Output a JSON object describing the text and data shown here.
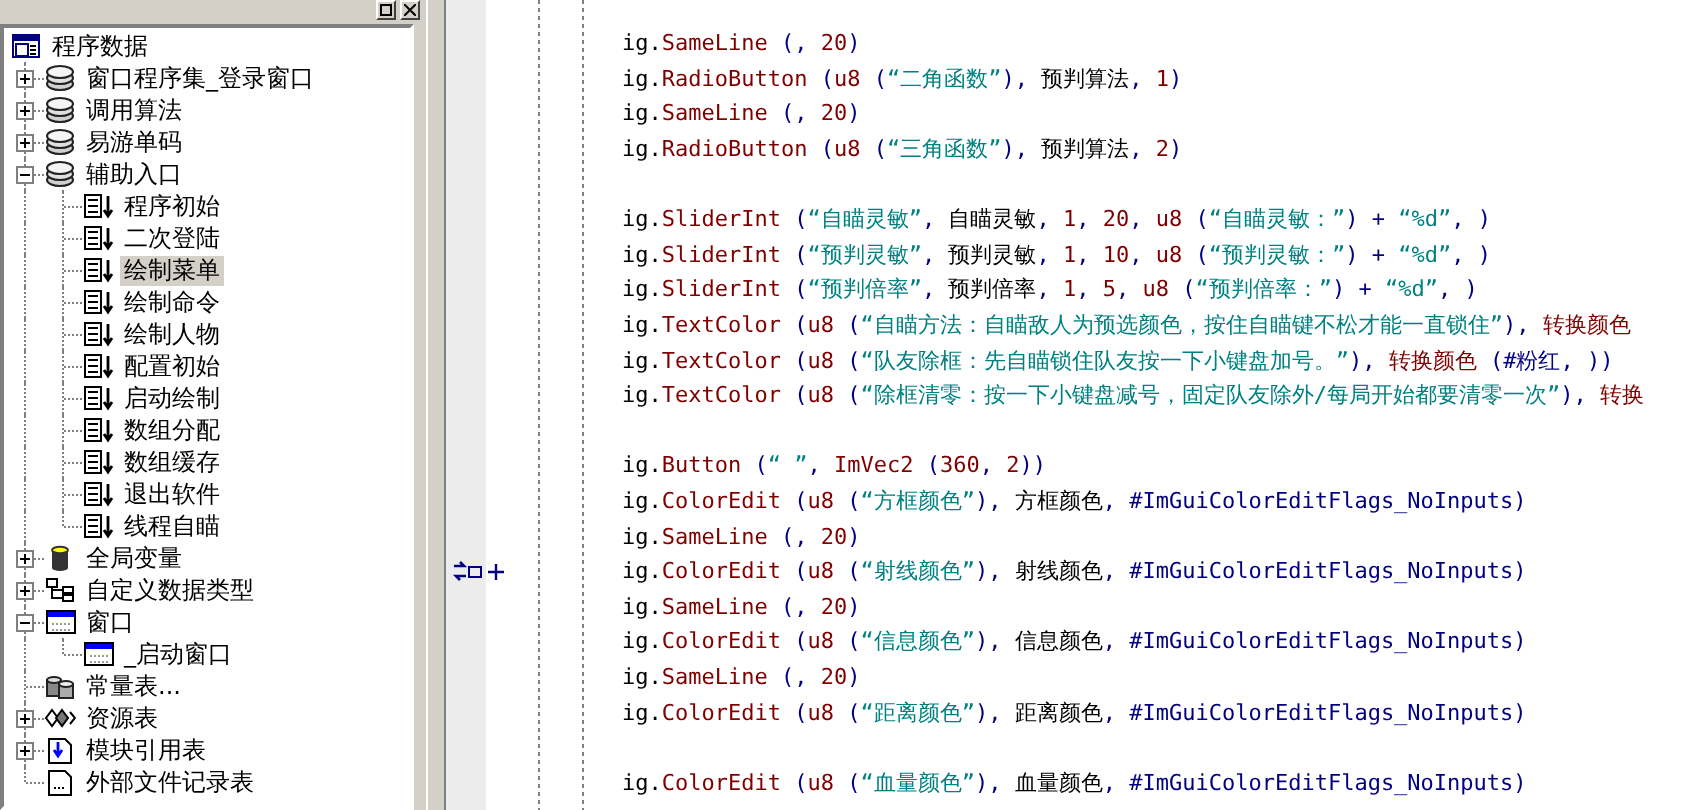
{
  "tree": [
    {
      "label": "程序数据",
      "kind": "program",
      "selected": false,
      "children": [
        {
          "label": "窗口程序集_登录窗口",
          "kind": "module",
          "selected": false,
          "expanded": false
        },
        {
          "label": "调用算法",
          "kind": "module",
          "selected": false,
          "expanded": false
        },
        {
          "label": "易游单码",
          "kind": "module",
          "selected": false,
          "expanded": false
        },
        {
          "label": "辅助入口",
          "kind": "module",
          "selected": false,
          "expanded": true,
          "children": [
            {
              "label": "程序初始",
              "kind": "sub",
              "selected": false
            },
            {
              "label": "二次登陆",
              "kind": "sub",
              "selected": false
            },
            {
              "label": "绘制菜单",
              "kind": "sub",
              "selected": true
            },
            {
              "label": "绘制命令",
              "kind": "sub",
              "selected": false
            },
            {
              "label": "绘制人物",
              "kind": "sub",
              "selected": false
            },
            {
              "label": "配置初始",
              "kind": "sub",
              "selected": false
            },
            {
              "label": "启动绘制",
              "kind": "sub",
              "selected": false
            },
            {
              "label": "数组分配",
              "kind": "sub",
              "selected": false
            },
            {
              "label": "数组缓存",
              "kind": "sub",
              "selected": false
            },
            {
              "label": "退出软件",
              "kind": "sub",
              "selected": false
            },
            {
              "label": "线程自瞄",
              "kind": "sub",
              "selected": false
            }
          ]
        },
        {
          "label": "全局变量",
          "kind": "globals",
          "selected": false,
          "expanded": false
        },
        {
          "label": "自定义数据类型",
          "kind": "datatype",
          "selected": false,
          "expanded": false
        },
        {
          "label": "窗口",
          "kind": "window",
          "selected": false,
          "expanded": true,
          "children": [
            {
              "label": "_启动窗口",
              "kind": "window",
              "selected": false
            }
          ]
        },
        {
          "label": "常量表...",
          "kind": "constants",
          "selected": false
        },
        {
          "label": "资源表",
          "kind": "resources",
          "selected": false,
          "expanded": false
        },
        {
          "label": "模块引用表",
          "kind": "modref",
          "selected": false,
          "expanded": false
        },
        {
          "label": "外部文件记录表",
          "kind": "file",
          "selected": false
        }
      ]
    }
  ],
  "code_lines": [
    {
      "marker": false,
      "tokens": [
        {
          "kind": "obj",
          "text": "ig."
        },
        {
          "kind": "func",
          "text": "SameLine"
        },
        {
          "kind": "punct",
          "text": " (, "
        },
        {
          "kind": "num",
          "text": "20"
        },
        {
          "kind": "punct",
          "text": ")"
        }
      ]
    },
    {
      "marker": false,
      "tokens": [
        {
          "kind": "obj",
          "text": "ig."
        },
        {
          "kind": "func",
          "text": "RadioButton"
        },
        {
          "kind": "punct",
          "text": " ("
        },
        {
          "kind": "func",
          "text": "u8"
        },
        {
          "kind": "punct",
          "text": " ("
        },
        {
          "kind": "str",
          "text": "“二角函数”"
        },
        {
          "kind": "punct",
          "text": "), "
        },
        {
          "kind": "var",
          "text": "预判算法"
        },
        {
          "kind": "punct",
          "text": ", "
        },
        {
          "kind": "num",
          "text": "1"
        },
        {
          "kind": "punct",
          "text": ")"
        }
      ]
    },
    {
      "marker": false,
      "tokens": [
        {
          "kind": "obj",
          "text": "ig."
        },
        {
          "kind": "func",
          "text": "SameLine"
        },
        {
          "kind": "punct",
          "text": " (, "
        },
        {
          "kind": "num",
          "text": "20"
        },
        {
          "kind": "punct",
          "text": ")"
        }
      ]
    },
    {
      "marker": false,
      "tokens": [
        {
          "kind": "obj",
          "text": "ig."
        },
        {
          "kind": "func",
          "text": "RadioButton"
        },
        {
          "kind": "punct",
          "text": " ("
        },
        {
          "kind": "func",
          "text": "u8"
        },
        {
          "kind": "punct",
          "text": " ("
        },
        {
          "kind": "str",
          "text": "“三角函数”"
        },
        {
          "kind": "punct",
          "text": "), "
        },
        {
          "kind": "var",
          "text": "预判算法"
        },
        {
          "kind": "punct",
          "text": ", "
        },
        {
          "kind": "num",
          "text": "2"
        },
        {
          "kind": "punct",
          "text": ")"
        }
      ]
    },
    {
      "marker": false
    },
    {
      "marker": false,
      "tokens": [
        {
          "kind": "obj",
          "text": "ig."
        },
        {
          "kind": "func",
          "text": "SliderInt"
        },
        {
          "kind": "punct",
          "text": " ("
        },
        {
          "kind": "str",
          "text": "“自瞄灵敏”"
        },
        {
          "kind": "punct",
          "text": ", "
        },
        {
          "kind": "var",
          "text": "自瞄灵敏"
        },
        {
          "kind": "punct",
          "text": ", "
        },
        {
          "kind": "num",
          "text": "1"
        },
        {
          "kind": "punct",
          "text": ", "
        },
        {
          "kind": "num",
          "text": "20"
        },
        {
          "kind": "punct",
          "text": ", "
        },
        {
          "kind": "func",
          "text": "u8"
        },
        {
          "kind": "punct",
          "text": " ("
        },
        {
          "kind": "str",
          "text": "“自瞄灵敏：”"
        },
        {
          "kind": "punct",
          "text": ") + "
        },
        {
          "kind": "str",
          "text": "“%d”"
        },
        {
          "kind": "punct",
          "text": ", )"
        }
      ]
    },
    {
      "marker": false,
      "tokens": [
        {
          "kind": "obj",
          "text": "ig."
        },
        {
          "kind": "func",
          "text": "SliderInt"
        },
        {
          "kind": "punct",
          "text": " ("
        },
        {
          "kind": "str",
          "text": "“预判灵敏”"
        },
        {
          "kind": "punct",
          "text": ", "
        },
        {
          "kind": "var",
          "text": "预判灵敏"
        },
        {
          "kind": "punct",
          "text": ", "
        },
        {
          "kind": "num",
          "text": "1"
        },
        {
          "kind": "punct",
          "text": ", "
        },
        {
          "kind": "num",
          "text": "10"
        },
        {
          "kind": "punct",
          "text": ", "
        },
        {
          "kind": "func",
          "text": "u8"
        },
        {
          "kind": "punct",
          "text": " ("
        },
        {
          "kind": "str",
          "text": "“预判灵敏：”"
        },
        {
          "kind": "punct",
          "text": ") + "
        },
        {
          "kind": "str",
          "text": "“%d”"
        },
        {
          "kind": "punct",
          "text": ", )"
        }
      ]
    },
    {
      "marker": false,
      "tokens": [
        {
          "kind": "obj",
          "text": "ig."
        },
        {
          "kind": "func",
          "text": "SliderInt"
        },
        {
          "kind": "punct",
          "text": " ("
        },
        {
          "kind": "str",
          "text": "“预判倍率”"
        },
        {
          "kind": "punct",
          "text": ", "
        },
        {
          "kind": "var",
          "text": "预判倍率"
        },
        {
          "kind": "punct",
          "text": ", "
        },
        {
          "kind": "num",
          "text": "1"
        },
        {
          "kind": "punct",
          "text": ", "
        },
        {
          "kind": "num",
          "text": "5"
        },
        {
          "kind": "punct",
          "text": ", "
        },
        {
          "kind": "func",
          "text": "u8"
        },
        {
          "kind": "punct",
          "text": " ("
        },
        {
          "kind": "str",
          "text": "“预判倍率：”"
        },
        {
          "kind": "punct",
          "text": ") + "
        },
        {
          "kind": "str",
          "text": "“%d”"
        },
        {
          "kind": "punct",
          "text": ", )"
        }
      ]
    },
    {
      "marker": false,
      "tokens": [
        {
          "kind": "obj",
          "text": "ig."
        },
        {
          "kind": "func",
          "text": "TextColor"
        },
        {
          "kind": "punct",
          "text": " ("
        },
        {
          "kind": "func",
          "text": "u8"
        },
        {
          "kind": "punct",
          "text": " ("
        },
        {
          "kind": "str",
          "text": "“自瞄方法：自瞄敌人为预选颜色，按住自瞄键不松才能一直锁住”"
        },
        {
          "kind": "punct",
          "text": "), "
        },
        {
          "kind": "func",
          "text": "转换颜色"
        }
      ]
    },
    {
      "marker": false,
      "tokens": [
        {
          "kind": "obj",
          "text": "ig."
        },
        {
          "kind": "func",
          "text": "TextColor"
        },
        {
          "kind": "punct",
          "text": " ("
        },
        {
          "kind": "func",
          "text": "u8"
        },
        {
          "kind": "punct",
          "text": " ("
        },
        {
          "kind": "str",
          "text": "“队友除框：先自瞄锁住队友按一下小键盘加号。”"
        },
        {
          "kind": "punct",
          "text": "), "
        },
        {
          "kind": "func",
          "text": "转换颜色"
        },
        {
          "kind": "punct",
          "text": " ("
        },
        {
          "kind": "const",
          "text": "#粉红"
        },
        {
          "kind": "punct",
          "text": ", ))"
        }
      ]
    },
    {
      "marker": false,
      "tokens": [
        {
          "kind": "obj",
          "text": "ig."
        },
        {
          "kind": "func",
          "text": "TextColor"
        },
        {
          "kind": "punct",
          "text": " ("
        },
        {
          "kind": "func",
          "text": "u8"
        },
        {
          "kind": "punct",
          "text": " ("
        },
        {
          "kind": "str",
          "text": "“除框清零：按一下小键盘减号，固定队友除外/每局开始都要清零一次”"
        },
        {
          "kind": "punct",
          "text": "), "
        },
        {
          "kind": "func",
          "text": "转换"
        }
      ]
    },
    {
      "marker": false
    },
    {
      "marker": false,
      "tokens": [
        {
          "kind": "obj",
          "text": "ig."
        },
        {
          "kind": "func",
          "text": "Button"
        },
        {
          "kind": "punct",
          "text": " ("
        },
        {
          "kind": "str",
          "text": "“ ”"
        },
        {
          "kind": "punct",
          "text": ", "
        },
        {
          "kind": "func",
          "text": "ImVec2"
        },
        {
          "kind": "punct",
          "text": " ("
        },
        {
          "kind": "num",
          "text": "360"
        },
        {
          "kind": "punct",
          "text": ", "
        },
        {
          "kind": "num",
          "text": "2"
        },
        {
          "kind": "punct",
          "text": "))"
        }
      ]
    },
    {
      "marker": false,
      "tokens": [
        {
          "kind": "obj",
          "text": "ig."
        },
        {
          "kind": "func",
          "text": "ColorEdit"
        },
        {
          "kind": "punct",
          "text": " ("
        },
        {
          "kind": "func",
          "text": "u8"
        },
        {
          "kind": "punct",
          "text": " ("
        },
        {
          "kind": "str",
          "text": "“方框颜色”"
        },
        {
          "kind": "punct",
          "text": "), "
        },
        {
          "kind": "var",
          "text": "方框颜色"
        },
        {
          "kind": "punct",
          "text": ", "
        },
        {
          "kind": "const",
          "text": "#ImGuiColorEditFlags_NoInputs"
        },
        {
          "kind": "punct",
          "text": ")"
        }
      ]
    },
    {
      "marker": false,
      "tokens": [
        {
          "kind": "obj",
          "text": "ig."
        },
        {
          "kind": "func",
          "text": "SameLine"
        },
        {
          "kind": "punct",
          "text": " (, "
        },
        {
          "kind": "num",
          "text": "20"
        },
        {
          "kind": "punct",
          "text": ")"
        }
      ]
    },
    {
      "marker": true,
      "tokens": [
        {
          "kind": "obj",
          "text": "ig."
        },
        {
          "kind": "func",
          "text": "ColorEdit"
        },
        {
          "kind": "punct",
          "text": " ("
        },
        {
          "kind": "func",
          "text": "u8"
        },
        {
          "kind": "punct",
          "text": " ("
        },
        {
          "kind": "str",
          "text": "“射线颜色”"
        },
        {
          "kind": "punct",
          "text": "), "
        },
        {
          "kind": "var",
          "text": "射线颜色"
        },
        {
          "kind": "punct",
          "text": ", "
        },
        {
          "kind": "const",
          "text": "#ImGuiColorEditFlags_NoInputs"
        },
        {
          "kind": "punct",
          "text": ")"
        }
      ]
    },
    {
      "marker": false,
      "tokens": [
        {
          "kind": "obj",
          "text": "ig."
        },
        {
          "kind": "func",
          "text": "SameLine"
        },
        {
          "kind": "punct",
          "text": " (, "
        },
        {
          "kind": "num",
          "text": "20"
        },
        {
          "kind": "punct",
          "text": ")"
        }
      ]
    },
    {
      "marker": false,
      "tokens": [
        {
          "kind": "obj",
          "text": "ig."
        },
        {
          "kind": "func",
          "text": "ColorEdit"
        },
        {
          "kind": "punct",
          "text": " ("
        },
        {
          "kind": "func",
          "text": "u8"
        },
        {
          "kind": "punct",
          "text": " ("
        },
        {
          "kind": "str",
          "text": "“信息颜色”"
        },
        {
          "kind": "punct",
          "text": "), "
        },
        {
          "kind": "var",
          "text": "信息颜色"
        },
        {
          "kind": "punct",
          "text": ", "
        },
        {
          "kind": "const",
          "text": "#ImGuiColorEditFlags_NoInputs"
        },
        {
          "kind": "punct",
          "text": ")"
        }
      ]
    },
    {
      "marker": false,
      "tokens": [
        {
          "kind": "obj",
          "text": "ig."
        },
        {
          "kind": "func",
          "text": "SameLine"
        },
        {
          "kind": "punct",
          "text": " (, "
        },
        {
          "kind": "num",
          "text": "20"
        },
        {
          "kind": "punct",
          "text": ")"
        }
      ]
    },
    {
      "marker": false,
      "tokens": [
        {
          "kind": "obj",
          "text": "ig."
        },
        {
          "kind": "func",
          "text": "ColorEdit"
        },
        {
          "kind": "punct",
          "text": " ("
        },
        {
          "kind": "func",
          "text": "u8"
        },
        {
          "kind": "punct",
          "text": " ("
        },
        {
          "kind": "str",
          "text": "“距离颜色”"
        },
        {
          "kind": "punct",
          "text": "), "
        },
        {
          "kind": "var",
          "text": "距离颜色"
        },
        {
          "kind": "punct",
          "text": ", "
        },
        {
          "kind": "const",
          "text": "#ImGuiColorEditFlags_NoInputs"
        },
        {
          "kind": "punct",
          "text": ")"
        }
      ]
    },
    {
      "marker": false
    },
    {
      "marker": false,
      "tokens": [
        {
          "kind": "obj",
          "text": "ig."
        },
        {
          "kind": "func",
          "text": "ColorEdit"
        },
        {
          "kind": "punct",
          "text": " ("
        },
        {
          "kind": "func",
          "text": "u8"
        },
        {
          "kind": "punct",
          "text": " ("
        },
        {
          "kind": "str",
          "text": "“血量颜色”"
        },
        {
          "kind": "punct",
          "text": "), "
        },
        {
          "kind": "var",
          "text": "血量颜色"
        },
        {
          "kind": "punct",
          "text": ", "
        },
        {
          "kind": "const",
          "text": "#ImGuiColorEditFlags_NoInputs"
        },
        {
          "kind": "punct",
          "text": ")"
        }
      ]
    }
  ]
}
